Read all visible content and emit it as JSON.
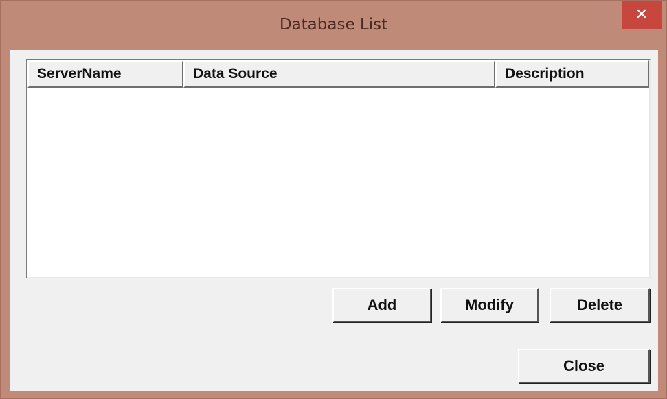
{
  "window": {
    "title": "Database List",
    "close_glyph": "✕"
  },
  "list": {
    "columns": [
      {
        "label": "ServerName"
      },
      {
        "label": "Data Source"
      },
      {
        "label": "Description"
      }
    ],
    "rows": []
  },
  "buttons": {
    "add_label": "Add",
    "modify_label": "Modify",
    "delete_label": "Delete",
    "close_label": "Close"
  },
  "colors": {
    "frame": "#c08a78",
    "close_button": "#c7473f",
    "client": "#f0f0f0"
  }
}
